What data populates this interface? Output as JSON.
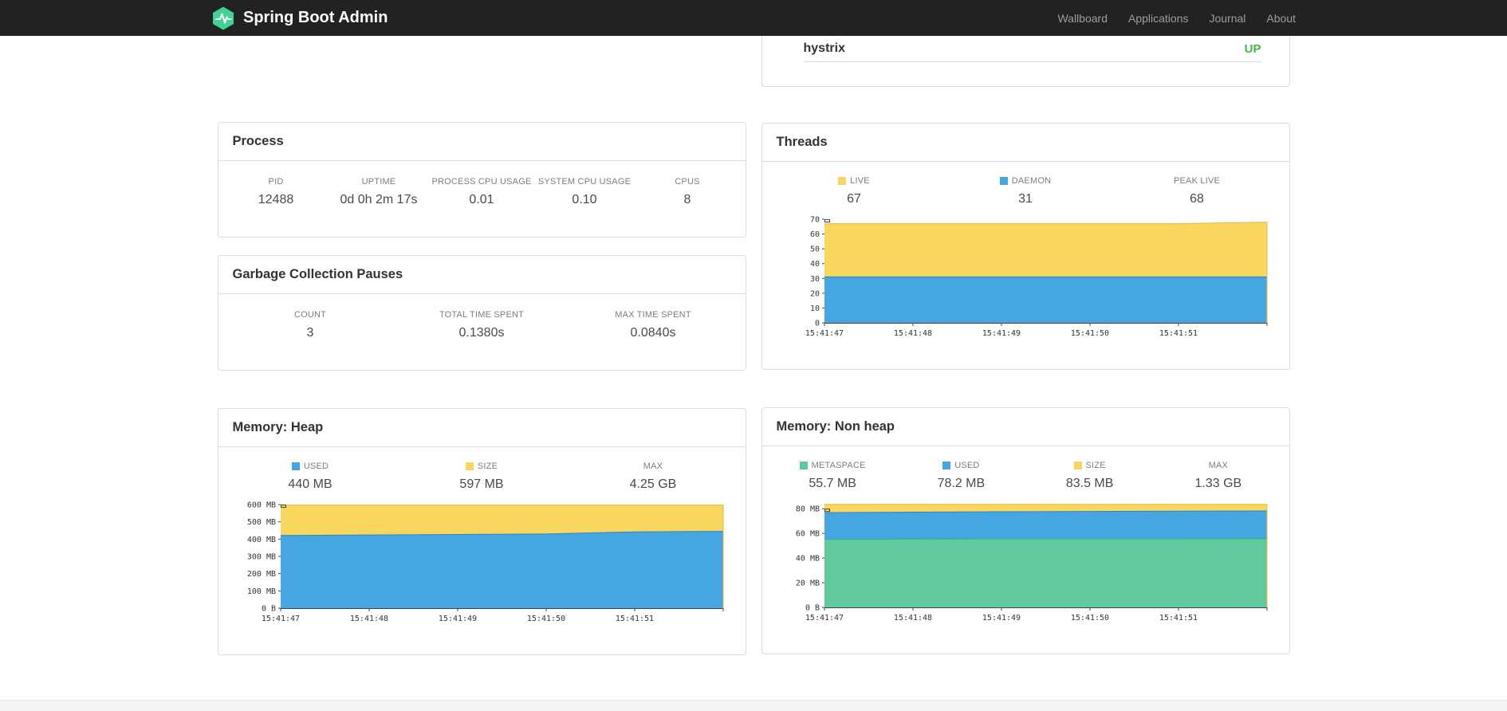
{
  "colors": {
    "brand": "#41d393",
    "navbar_bg": "#222222",
    "status_up": "#44b549"
  },
  "navbar": {
    "brand": "Spring Boot Admin",
    "items": [
      {
        "label": "Wallboard"
      },
      {
        "label": "Applications"
      },
      {
        "label": "Journal"
      },
      {
        "label": "About"
      }
    ]
  },
  "applications": {
    "rows": [
      {
        "name": "hystrix",
        "status": "UP",
        "status_color": "#44b549"
      }
    ]
  },
  "process": {
    "title": "Process",
    "stats": [
      {
        "label": "PID",
        "value": "12488"
      },
      {
        "label": "UPTIME",
        "value": "0d 0h 2m 17s"
      },
      {
        "label": "PROCESS CPU USAGE",
        "value": "0.01"
      },
      {
        "label": "SYSTEM CPU USAGE",
        "value": "0.10"
      },
      {
        "label": "CPUS",
        "value": "8"
      }
    ]
  },
  "gc": {
    "title": "Garbage Collection Pauses",
    "stats": [
      {
        "label": "COUNT",
        "value": "3"
      },
      {
        "label": "TOTAL TIME SPENT",
        "value": "0.1380s"
      },
      {
        "label": "MAX TIME SPENT",
        "value": "0.0840s"
      }
    ]
  },
  "threads": {
    "title": "Threads",
    "stats": [
      {
        "label": "LIVE",
        "value": "67",
        "swatch": "#f9d65d"
      },
      {
        "label": "DAEMON",
        "value": "31",
        "swatch": "#45a6e2"
      },
      {
        "label": "PEAK LIVE",
        "value": "68"
      }
    ]
  },
  "memory_heap": {
    "title": "Memory: Heap",
    "stats": [
      {
        "label": "USED",
        "value": "440 MB",
        "swatch": "#45a6e2"
      },
      {
        "label": "SIZE",
        "value": "597 MB",
        "swatch": "#f9d65d"
      },
      {
        "label": "MAX",
        "value": "4.25 GB"
      }
    ]
  },
  "memory_nonheap": {
    "title": "Memory: Non heap",
    "stats": [
      {
        "label": "METASPACE",
        "value": "55.7 MB",
        "swatch": "#62c99f"
      },
      {
        "label": "USED",
        "value": "78.2 MB",
        "swatch": "#45a6e2"
      },
      {
        "label": "SIZE",
        "value": "83.5 MB",
        "swatch": "#f9d65d"
      },
      {
        "label": "MAX",
        "value": "1.33 GB"
      }
    ]
  },
  "chart_data": [
    {
      "id": "threads",
      "type": "area",
      "title": "Threads",
      "stacked": true,
      "x": [
        "15:41:47",
        "15:41:48",
        "15:41:49",
        "15:41:50",
        "15:41:51"
      ],
      "ylim": [
        0,
        70
      ],
      "y_ticks": [
        0,
        10,
        20,
        30,
        40,
        50,
        60,
        70
      ],
      "y_tick_labels": [
        "0",
        "10",
        "20",
        "30",
        "40",
        "50",
        "60",
        "70"
      ],
      "series": [
        {
          "name": "DAEMON",
          "color": "#45a6e2",
          "stroke": "#2b87c8",
          "values": [
            31,
            31,
            31,
            31,
            31,
            31
          ]
        },
        {
          "name": "LIVE",
          "color": "#f9d65d",
          "stroke": "#dfbc3e",
          "values": [
            67,
            67,
            67,
            67,
            67,
            68
          ]
        }
      ]
    },
    {
      "id": "memory-heap",
      "type": "area",
      "title": "Memory: Heap",
      "stacked": true,
      "x": [
        "15:41:47",
        "15:41:48",
        "15:41:49",
        "15:41:50",
        "15:41:51"
      ],
      "ylim": [
        0,
        600
      ],
      "y_ticks": [
        0,
        100,
        200,
        300,
        400,
        500,
        600
      ],
      "y_tick_labels": [
        "0 B",
        "100 MB",
        "200 MB",
        "300 MB",
        "400 MB",
        "500 MB",
        "600 MB"
      ],
      "series": [
        {
          "name": "USED",
          "color": "#45a6e2",
          "stroke": "#2b87c8",
          "values": [
            421,
            424,
            427,
            430,
            442,
            445
          ]
        },
        {
          "name": "SIZE",
          "color": "#f9d65d",
          "stroke": "#dfbc3e",
          "values": [
            597,
            597,
            597,
            597,
            597,
            597
          ]
        }
      ]
    },
    {
      "id": "memory-nonheap",
      "type": "area",
      "title": "Memory: Non heap",
      "stacked": true,
      "x": [
        "15:41:47",
        "15:41:48",
        "15:41:49",
        "15:41:50",
        "15:41:51"
      ],
      "ylim": [
        0,
        84
      ],
      "y_ticks": [
        0,
        20,
        40,
        60,
        80
      ],
      "y_tick_labels": [
        "0 B",
        "20 MB",
        "40 MB",
        "60 MB",
        "80 MB"
      ],
      "series": [
        {
          "name": "METASPACE",
          "color": "#62c99f",
          "stroke": "#43ad85",
          "values": [
            55.2,
            55.3,
            55.4,
            55.5,
            55.6,
            55.7
          ]
        },
        {
          "name": "USED",
          "color": "#45a6e2",
          "stroke": "#2b87c8",
          "values": [
            76.8,
            77.2,
            77.5,
            77.8,
            78.0,
            78.2
          ]
        },
        {
          "name": "SIZE",
          "color": "#f9d65d",
          "stroke": "#dfbc3e",
          "values": [
            83.5,
            83.5,
            83.5,
            83.5,
            83.5,
            83.5
          ]
        }
      ]
    }
  ]
}
